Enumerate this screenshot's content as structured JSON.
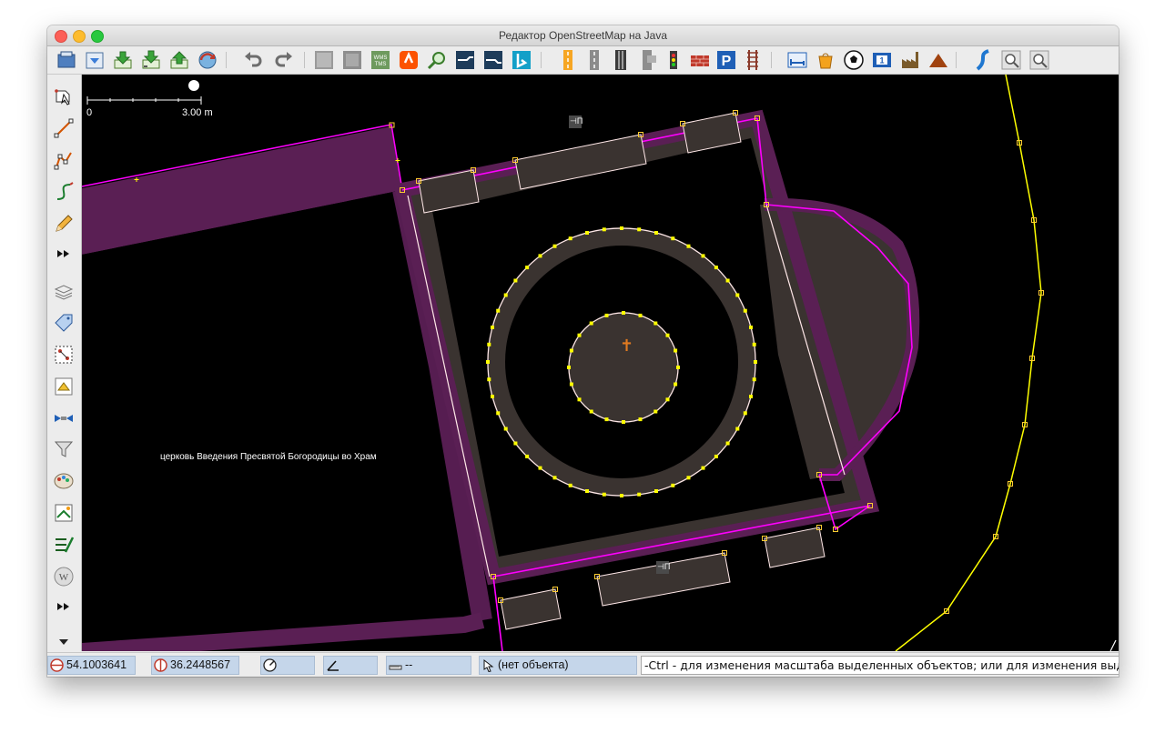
{
  "window": {
    "title": "Редактор OpenStreetMap на Java"
  },
  "toolbar": {
    "buttons": [
      {
        "name": "open-file-icon"
      },
      {
        "name": "download-icon"
      },
      {
        "name": "download-data-icon"
      },
      {
        "name": "download-overpass-icon"
      },
      {
        "name": "upload-icon"
      },
      {
        "name": "update-data-icon"
      },
      {
        "name": "undo-icon"
      },
      {
        "name": "redo-icon"
      },
      {
        "name": "imagery-icon-1"
      },
      {
        "name": "imagery-icon-2"
      },
      {
        "name": "wms-tms-icon"
      },
      {
        "name": "strava-icon"
      },
      {
        "name": "zoom-search-icon"
      },
      {
        "name": "mapbox-icon"
      },
      {
        "name": "mapbox-icon-2"
      },
      {
        "name": "bing-icon"
      },
      {
        "name": "road-icon"
      },
      {
        "name": "street-icon"
      },
      {
        "name": "highway-icon"
      },
      {
        "name": "junction-icon"
      },
      {
        "name": "traffic-light-icon"
      },
      {
        "name": "wall-icon"
      },
      {
        "name": "parking-icon"
      },
      {
        "name": "railway-icon"
      },
      {
        "name": "hotel-icon"
      },
      {
        "name": "shop-icon"
      },
      {
        "name": "sport-icon"
      },
      {
        "name": "number-icon"
      },
      {
        "name": "industrial-icon"
      },
      {
        "name": "peak-icon"
      },
      {
        "name": "waterway-icon"
      },
      {
        "name": "zoom-in-icon"
      },
      {
        "name": "zoom-out-icon"
      }
    ]
  },
  "map": {
    "scale": {
      "start_label": "0",
      "end_label": "3.00 m"
    },
    "feature_label": "церковь Введения Пресвятой Богородицы во Храм",
    "entrance_label": "⊣П",
    "church_symbol": "✝"
  },
  "statusbar": {
    "lat": "54.1003641",
    "lon": "36.2448567",
    "heading": "",
    "angle": "",
    "distance": "--",
    "object": "(нет объекта)",
    "hint": "-Ctrl - для изменения масштаба выделенных объектов; или для изменения выделения"
  },
  "colors": {
    "building_outline": "#ff00ff",
    "building_fill": "#55204f",
    "area_fill": "#3a3330",
    "way_selected": "#ffe8e8",
    "node": "#ffff00",
    "path": "#ffff00",
    "statusfield": "#c5d6ea"
  }
}
